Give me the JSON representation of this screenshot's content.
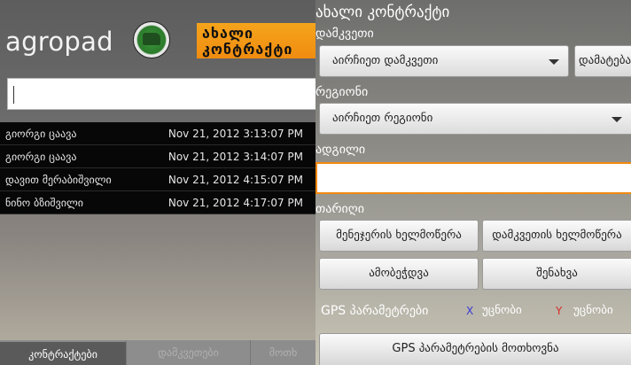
{
  "app": {
    "logo_text": "agropad",
    "new_contract_label": "ახალი კონტრაქტი"
  },
  "search": {
    "value": ""
  },
  "contracts": [
    {
      "name": "გიორგი ცაავა",
      "date": "Nov 21, 2012 3:13:07 PM"
    },
    {
      "name": "გიორგი ცაავა",
      "date": "Nov 21, 2012 3:14:07 PM"
    },
    {
      "name": "დავით მერაბიშვილი",
      "date": "Nov 21, 2012 4:15:07 PM"
    },
    {
      "name": "ნინო ბზიშვილი",
      "date": "Nov 21, 2012 4:17:07 PM"
    }
  ],
  "tabs": [
    {
      "label": "კონტრაქტები",
      "active": true
    },
    {
      "label": "დამკვეთები",
      "active": false
    },
    {
      "label": "მოთხ",
      "active": false
    }
  ],
  "form": {
    "title": "ახალი კონტრაქტი",
    "customer_label": "დამკვეთი",
    "customer_select": "აირჩიეთ დამკვეთი",
    "add_customer_button": "დამატება",
    "region_label": "რეგიონი",
    "region_select": "აირჩიეთ რეგიონი",
    "place_label": "ადგილი",
    "place_value": "",
    "date_label": "თარიღი",
    "manager_signature_button": "მენეჯერის ხელმოწერა",
    "customer_signature_button": "დამკვეთის ხელმოწერა",
    "print_button": "ამობეჭდვა",
    "save_button": "შენახვა",
    "gps_label": "GPS პარამეტრები",
    "x_label": "X",
    "x_value": "უცნობი",
    "y_label": "Y",
    "y_value": "უცნობი",
    "gps_request_button": "GPS პარამეტრების მოთხოვნა"
  },
  "colors": {
    "accent": "#f08c10",
    "x_color": "#3a3ad8",
    "y_color": "#d82a2a"
  }
}
